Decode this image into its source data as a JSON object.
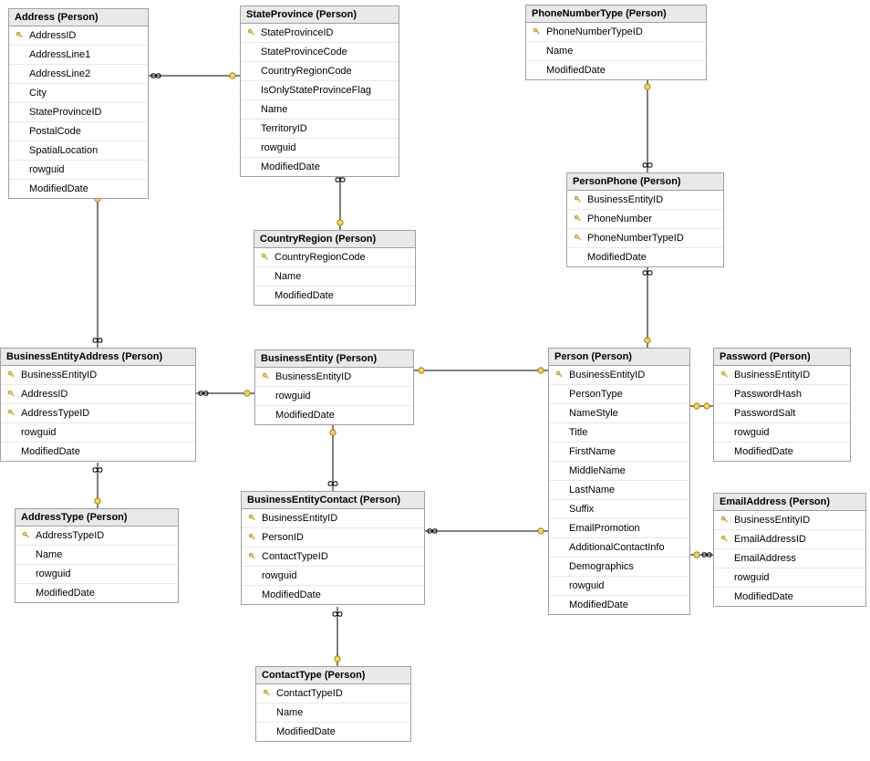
{
  "tables": {
    "address": {
      "title": "Address (Person)",
      "cols": [
        {
          "name": "AddressID",
          "pk": true
        },
        {
          "name": "AddressLine1",
          "pk": false
        },
        {
          "name": "AddressLine2",
          "pk": false
        },
        {
          "name": "City",
          "pk": false
        },
        {
          "name": "StateProvinceID",
          "pk": false
        },
        {
          "name": "PostalCode",
          "pk": false
        },
        {
          "name": "SpatialLocation",
          "pk": false
        },
        {
          "name": "rowguid",
          "pk": false
        },
        {
          "name": "ModifiedDate",
          "pk": false
        }
      ]
    },
    "stateprovince": {
      "title": "StateProvince (Person)",
      "cols": [
        {
          "name": "StateProvinceID",
          "pk": true
        },
        {
          "name": "StateProvinceCode",
          "pk": false
        },
        {
          "name": "CountryRegionCode",
          "pk": false
        },
        {
          "name": "IsOnlyStateProvinceFlag",
          "pk": false
        },
        {
          "name": "Name",
          "pk": false
        },
        {
          "name": "TerritoryID",
          "pk": false
        },
        {
          "name": "rowguid",
          "pk": false
        },
        {
          "name": "ModifiedDate",
          "pk": false
        }
      ]
    },
    "phonenumbertype": {
      "title": "PhoneNumberType (Person)",
      "cols": [
        {
          "name": "PhoneNumberTypeID",
          "pk": true
        },
        {
          "name": "Name",
          "pk": false
        },
        {
          "name": "ModifiedDate",
          "pk": false
        }
      ]
    },
    "countryregion": {
      "title": "CountryRegion (Person)",
      "cols": [
        {
          "name": "CountryRegionCode",
          "pk": true
        },
        {
          "name": "Name",
          "pk": false
        },
        {
          "name": "ModifiedDate",
          "pk": false
        }
      ]
    },
    "personphone": {
      "title": "PersonPhone (Person)",
      "cols": [
        {
          "name": "BusinessEntityID",
          "pk": true
        },
        {
          "name": "PhoneNumber",
          "pk": true
        },
        {
          "name": "PhoneNumberTypeID",
          "pk": true
        },
        {
          "name": "ModifiedDate",
          "pk": false
        }
      ]
    },
    "businessentityaddress": {
      "title": "BusinessEntityAddress (Person)",
      "cols": [
        {
          "name": "BusinessEntityID",
          "pk": true
        },
        {
          "name": "AddressID",
          "pk": true
        },
        {
          "name": "AddressTypeID",
          "pk": true
        },
        {
          "name": "rowguid",
          "pk": false
        },
        {
          "name": "ModifiedDate",
          "pk": false
        }
      ]
    },
    "businessentity": {
      "title": "BusinessEntity (Person)",
      "cols": [
        {
          "name": "BusinessEntityID",
          "pk": true
        },
        {
          "name": "rowguid",
          "pk": false
        },
        {
          "name": "ModifiedDate",
          "pk": false
        }
      ]
    },
    "person": {
      "title": "Person (Person)",
      "cols": [
        {
          "name": "BusinessEntityID",
          "pk": true
        },
        {
          "name": "PersonType",
          "pk": false
        },
        {
          "name": "NameStyle",
          "pk": false
        },
        {
          "name": "Title",
          "pk": false
        },
        {
          "name": "FirstName",
          "pk": false
        },
        {
          "name": "MiddleName",
          "pk": false
        },
        {
          "name": "LastName",
          "pk": false
        },
        {
          "name": "Suffix",
          "pk": false
        },
        {
          "name": "EmailPromotion",
          "pk": false
        },
        {
          "name": "AdditionalContactInfo",
          "pk": false
        },
        {
          "name": "Demographics",
          "pk": false
        },
        {
          "name": "rowguid",
          "pk": false
        },
        {
          "name": "ModifiedDate",
          "pk": false
        }
      ]
    },
    "password": {
      "title": "Password (Person)",
      "cols": [
        {
          "name": "BusinessEntityID",
          "pk": true
        },
        {
          "name": "PasswordHash",
          "pk": false
        },
        {
          "name": "PasswordSalt",
          "pk": false
        },
        {
          "name": "rowguid",
          "pk": false
        },
        {
          "name": "ModifiedDate",
          "pk": false
        }
      ]
    },
    "addresstype": {
      "title": "AddressType (Person)",
      "cols": [
        {
          "name": "AddressTypeID",
          "pk": true
        },
        {
          "name": "Name",
          "pk": false
        },
        {
          "name": "rowguid",
          "pk": false
        },
        {
          "name": "ModifiedDate",
          "pk": false
        }
      ]
    },
    "businessentitycontact": {
      "title": "BusinessEntityContact (Person)",
      "cols": [
        {
          "name": "BusinessEntityID",
          "pk": true
        },
        {
          "name": "PersonID",
          "pk": true
        },
        {
          "name": "ContactTypeID",
          "pk": true
        },
        {
          "name": "rowguid",
          "pk": false
        },
        {
          "name": "ModifiedDate",
          "pk": false
        }
      ]
    },
    "emailaddress": {
      "title": "EmailAddress (Person)",
      "cols": [
        {
          "name": "BusinessEntityID",
          "pk": true
        },
        {
          "name": "EmailAddressID",
          "pk": true
        },
        {
          "name": "EmailAddress",
          "pk": false
        },
        {
          "name": "rowguid",
          "pk": false
        },
        {
          "name": "ModifiedDate",
          "pk": false
        }
      ]
    },
    "contacttype": {
      "title": "ContactType (Person)",
      "cols": [
        {
          "name": "ContactTypeID",
          "pk": true
        },
        {
          "name": "Name",
          "pk": false
        },
        {
          "name": "ModifiedDate",
          "pk": false
        }
      ]
    }
  }
}
